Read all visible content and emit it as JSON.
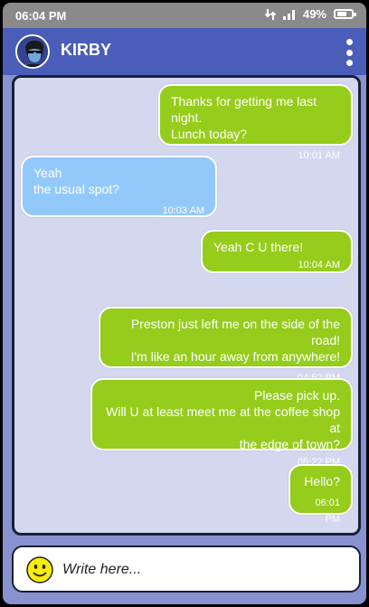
{
  "status": {
    "time": "06:04 PM",
    "battery": "49%"
  },
  "header": {
    "contact_name": "KIRBY"
  },
  "messages": [
    {
      "direction": "out",
      "text": "Thanks for getting me last night.\nLunch today?",
      "time": "10:01 AM"
    },
    {
      "direction": "in",
      "text": "Yeah\nthe usual spot?",
      "time": "10:03 AM"
    },
    {
      "direction": "out",
      "text": "Yeah C U there!",
      "time": "10:04 AM"
    },
    {
      "direction": "out",
      "text": "Preston just left me on the side of the road!\nI'm like an hour away from anywhere!",
      "time": "04:52 PM"
    },
    {
      "direction": "out",
      "text": "Please pick up.\nWill U at least meet me at the coffee shop at\nthe edge of town?",
      "time": "05:22 PM"
    },
    {
      "direction": "out",
      "text": "Hello?",
      "time": "06:01 PM"
    }
  ],
  "composer": {
    "placeholder": "Write here..."
  },
  "colors": {
    "outgoing": "#96cc1b",
    "incoming": "#93c9fa",
    "header": "#4a5db8",
    "chat_background": "#d3d8ef"
  }
}
